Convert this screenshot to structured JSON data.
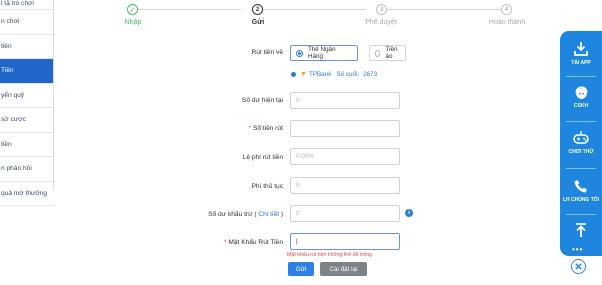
{
  "sidebar": {
    "items": [
      {
        "label": "i tặ trò chơi"
      },
      {
        "label": "n chơi"
      },
      {
        "label": "tiền"
      },
      {
        "label": "Tiền",
        "active": true
      },
      {
        "label": "yển quỹ"
      },
      {
        "label": "sử cược"
      },
      {
        "label": "tiền"
      },
      {
        "label": "n phản hồi"
      },
      {
        "label": "quả mở thưởng"
      }
    ]
  },
  "steps": [
    {
      "num": "✓",
      "label": "Nhập",
      "state": "done"
    },
    {
      "num": "2",
      "label": "Gửi",
      "state": "current"
    },
    {
      "num": "3",
      "label": "Phê duyệt",
      "state": "pending"
    },
    {
      "num": "4",
      "label": "Hoàn thành",
      "state": "pending"
    }
  ],
  "form": {
    "withdraw_to_label": "Rút tiền về",
    "option_bank": "Thẻ Ngân Hàng",
    "option_virtual": "Tiền ảo",
    "bank_name": "TPBank",
    "bank_suffix_label": "Số cuối:",
    "bank_suffix": "2673",
    "balance_label": "Số dư hiện tại",
    "balance_value": "0",
    "amount_label": "Số tiền rút",
    "amount_value": "",
    "fee_label": "Lệ phí rút tiền",
    "fee_value": "0.00%",
    "service_fee_label": "Phí thủ tục",
    "service_fee_value": "0",
    "deduction_label": "Số dư khấu trừ (",
    "deduction_link": "Chi tiết",
    "deduction_close": ")",
    "deduction_value": "0",
    "password_label": "Mật Khẩu Rút Tiền",
    "password_value": "|",
    "required_mark": "*",
    "password_error": "Mật khẩu rút tiền không thể để trống",
    "submit": "Gửi",
    "reset": "Cài đặt lại"
  },
  "float_panel": {
    "items": [
      {
        "label": "TẢI APP",
        "icon": "download-icon"
      },
      {
        "label": "CSKH",
        "icon": "support-icon"
      },
      {
        "label": "CHƠI THỬ",
        "icon": "gamepad-icon"
      },
      {
        "label": "LH CHÚNG TÔI",
        "icon": "phone-icon"
      },
      {
        "label": "",
        "icon": "arrow-up-icon"
      }
    ],
    "more": "•••"
  },
  "colors": {
    "primary": "#2f80e6",
    "sidebar_active": "#1f66c8",
    "float_panel": "#1f86e0",
    "step_done": "#3fbf6a",
    "error": "#e5484d"
  }
}
